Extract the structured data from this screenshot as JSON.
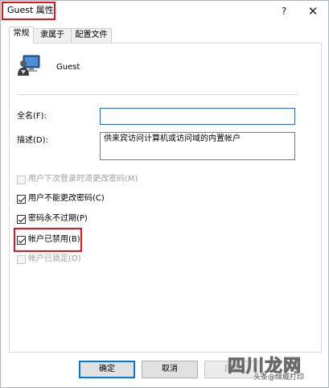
{
  "window": {
    "title": "Guest 属性",
    "help": "?",
    "close": "✕"
  },
  "tabs": [
    {
      "label": "常规",
      "active": true
    },
    {
      "label": "隶属于",
      "active": false
    },
    {
      "label": "配置文件",
      "active": false
    }
  ],
  "user": {
    "icon": "user-computer-icon",
    "name": "Guest"
  },
  "fields": {
    "fullname_label": "全名(F):",
    "fullname_value": "",
    "description_label": "描述(D):",
    "description_value": "供来宾访问计算机或访问域的内置帐户"
  },
  "checkboxes": [
    {
      "label": "用户下次登录时须更改密码(M)",
      "checked": false,
      "disabled": true
    },
    {
      "label": "用户不能更改密码(C)",
      "checked": true,
      "disabled": false
    },
    {
      "label": "密码永不过期(P)",
      "checked": true,
      "disabled": false
    },
    {
      "label": "帐户已禁用(B)",
      "checked": true,
      "disabled": false
    },
    {
      "label": "帐户已锁定(O)",
      "checked": false,
      "disabled": true
    }
  ],
  "buttons": {
    "ok": "确定",
    "cancel": "取消",
    "apply": "应用"
  },
  "watermark": {
    "logo": "四川龙网",
    "caption": "头条@缔威打印"
  },
  "colors": {
    "highlight_box": "#e8131c",
    "focus_border": "#0078d7"
  }
}
